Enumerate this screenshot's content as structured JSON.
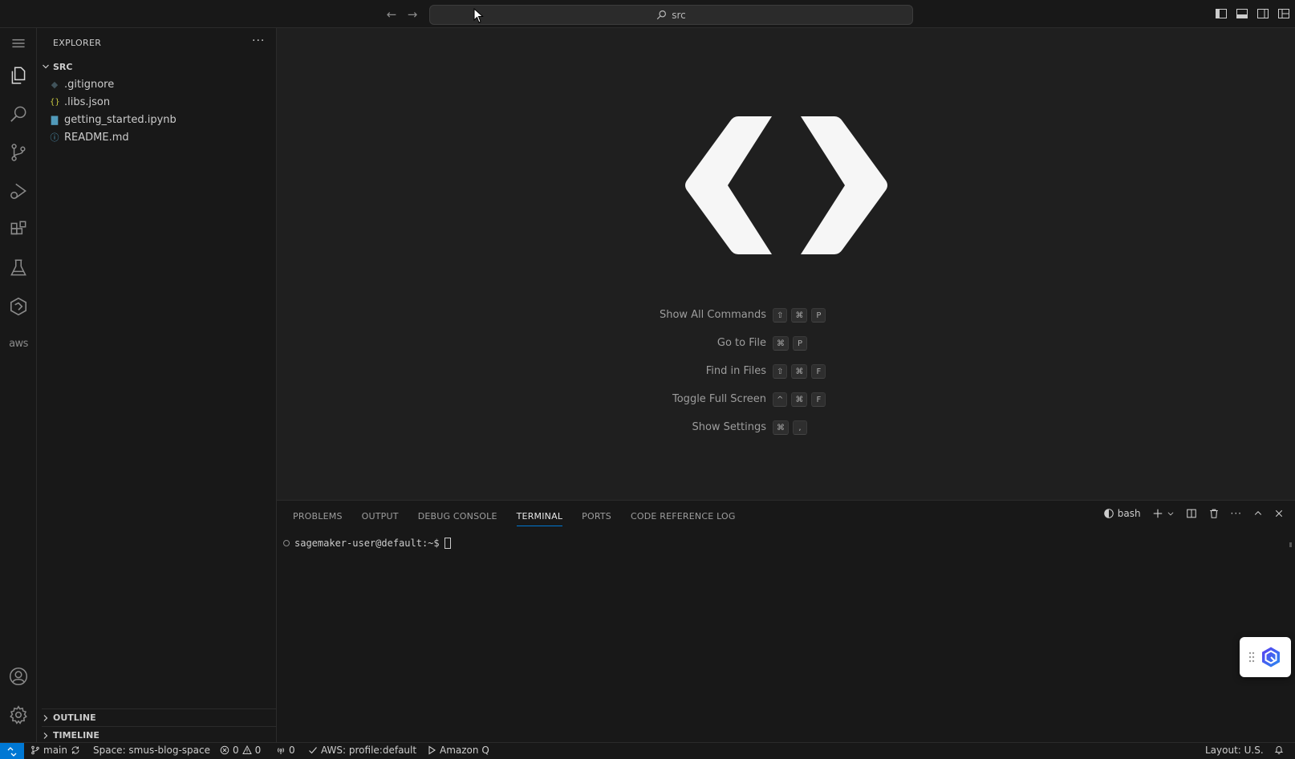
{
  "titlebar": {
    "search_text": "src"
  },
  "activitybar": {
    "items": [
      {
        "name": "menu-icon"
      },
      {
        "name": "explorer-icon"
      },
      {
        "name": "search-icon"
      },
      {
        "name": "source-control-icon"
      },
      {
        "name": "run-debug-icon"
      },
      {
        "name": "extensions-icon"
      },
      {
        "name": "testing-icon"
      },
      {
        "name": "sagemaker-icon"
      },
      {
        "name": "aws-icon",
        "label": "aws"
      },
      {
        "name": "account-icon"
      },
      {
        "name": "settings-gear-icon"
      }
    ]
  },
  "sidebar": {
    "title": "EXPLORER",
    "folder": "SRC",
    "files": [
      {
        "name": ".gitignore",
        "icon": "gitignore-icon"
      },
      {
        "name": ".libs.json",
        "icon": "json-icon"
      },
      {
        "name": "getting_started.ipynb",
        "icon": "notebook-icon"
      },
      {
        "name": "README.md",
        "icon": "info-icon"
      }
    ],
    "outline": "OUTLINE",
    "timeline": "TIMELINE"
  },
  "editor": {
    "shortcuts": [
      {
        "label": "Show All Commands",
        "keys": [
          "⇧",
          "⌘",
          "P"
        ]
      },
      {
        "label": "Go to File",
        "keys": [
          "⌘",
          "P"
        ]
      },
      {
        "label": "Find in Files",
        "keys": [
          "⇧",
          "⌘",
          "F"
        ]
      },
      {
        "label": "Toggle Full Screen",
        "keys": [
          "^",
          "⌘",
          "F"
        ]
      },
      {
        "label": "Show Settings",
        "keys": [
          "⌘",
          ","
        ]
      }
    ]
  },
  "panel": {
    "tabs": [
      {
        "label": "PROBLEMS",
        "active": false
      },
      {
        "label": "OUTPUT",
        "active": false
      },
      {
        "label": "DEBUG CONSOLE",
        "active": false
      },
      {
        "label": "TERMINAL",
        "active": true
      },
      {
        "label": "PORTS",
        "active": false
      },
      {
        "label": "CODE REFERENCE LOG",
        "active": false
      }
    ],
    "shell": "bash",
    "prompt": "sagemaker-user@default:~$"
  },
  "statusbar": {
    "branch": "main",
    "space": "Space: smus-blog-space",
    "errors": "0",
    "warnings": "0",
    "ports": "0",
    "aws_profile": "AWS: profile:default",
    "amazon_q": "Amazon Q",
    "layout": "Layout: U.S."
  },
  "colors": {
    "accent": "#0078d4",
    "background": "#1f1f1f",
    "sidebar": "#181818"
  }
}
